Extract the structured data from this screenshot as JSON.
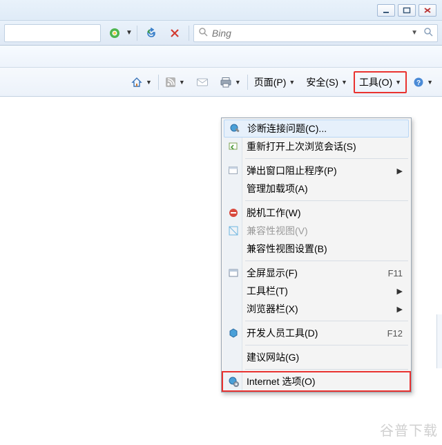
{
  "window_controls": {
    "minimize": "–",
    "maximize": "❐",
    "close": "✕"
  },
  "search": {
    "placeholder": "Bing"
  },
  "cmdbar": {
    "page": "页面(P)",
    "safety": "安全(S)",
    "tools": "工具(O)",
    "help_aria": "帮助"
  },
  "tools_menu": {
    "items": {
      "diagnose": {
        "label": "诊断连接问题(C)...",
        "accel": "",
        "sub": false
      },
      "reopen": {
        "label": "重新打开上次浏览会话(S)",
        "accel": "",
        "sub": false
      },
      "popup": {
        "label": "弹出窗口阻止程序(P)",
        "accel": "",
        "sub": true
      },
      "addons": {
        "label": "管理加载项(A)",
        "accel": "",
        "sub": false
      },
      "offline": {
        "label": "脱机工作(W)",
        "accel": "",
        "sub": false
      },
      "compat": {
        "label": "兼容性视图(V)",
        "accel": "",
        "sub": false,
        "disabled": true
      },
      "compat_set": {
        "label": "兼容性视图设置(B)",
        "accel": "",
        "sub": false
      },
      "fullscreen": {
        "label": "全屏显示(F)",
        "accel": "F11",
        "sub": false
      },
      "toolbars": {
        "label": "工具栏(T)",
        "accel": "",
        "sub": true
      },
      "explorerbars": {
        "label": "浏览器栏(X)",
        "accel": "",
        "sub": true
      },
      "devtools": {
        "label": "开发人员工具(D)",
        "accel": "F12",
        "sub": false
      },
      "suggested": {
        "label": "建议网站(G)",
        "accel": "",
        "sub": false
      },
      "inetopts": {
        "label": "Internet 选项(O)",
        "accel": "",
        "sub": false
      }
    }
  },
  "watermark": "谷普下载"
}
